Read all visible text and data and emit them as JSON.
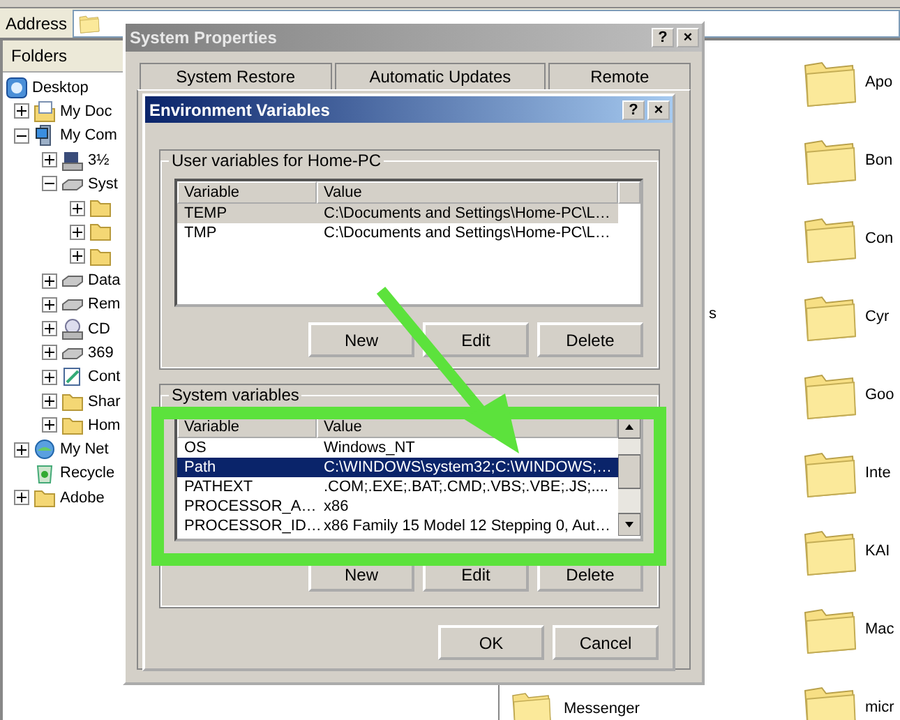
{
  "address_bar": {
    "label": "Address"
  },
  "folders_pane": {
    "title": "Folders",
    "tree": [
      {
        "label": "Desktop",
        "kind": "desktop",
        "children": [
          {
            "label": "My Doc",
            "kind": "documents",
            "expanded": false
          },
          {
            "label": "My Com",
            "kind": "computer",
            "expanded": true,
            "children": [
              {
                "label": "3½",
                "kind": "floppy",
                "expanded": false
              },
              {
                "label": "Syst",
                "kind": "drive",
                "expanded": true,
                "children": [
                  {
                    "kind": "folder",
                    "expanded": false
                  },
                  {
                    "kind": "folder",
                    "expanded": false
                  },
                  {
                    "kind": "folder",
                    "expanded": false
                  }
                ]
              },
              {
                "label": "Data",
                "kind": "drive",
                "expanded": false
              },
              {
                "label": "Rem",
                "kind": "drive",
                "expanded": false
              },
              {
                "label": "CD",
                "kind": "cdrom",
                "expanded": false
              },
              {
                "label": "369",
                "kind": "drive",
                "expanded": false
              },
              {
                "label": "Cont",
                "kind": "control",
                "expanded": false
              },
              {
                "label": "Shar",
                "kind": "folder",
                "expanded": false
              },
              {
                "label": "Hom",
                "kind": "folder",
                "expanded": false
              }
            ]
          },
          {
            "label": "My Net",
            "kind": "network",
            "expanded": false
          },
          {
            "label": "Recycle",
            "kind": "recycle"
          },
          {
            "label": "Adobe",
            "kind": "folder",
            "expanded": false
          }
        ]
      }
    ]
  },
  "file_list": {
    "column_fragments": [
      "s",
      "Messenger"
    ],
    "items": [
      "Apo",
      "Bon",
      "Con",
      "Cyr",
      "Goo",
      "Inte",
      "KAI",
      "Mac",
      "micr"
    ]
  },
  "system_properties": {
    "title": "System Properties",
    "title_buttons": [
      "?",
      "×"
    ],
    "tabs": [
      "System Restore",
      "Automatic Updates",
      "Remote"
    ]
  },
  "environment_variables": {
    "title": "Environment Variables",
    "title_buttons": [
      "?",
      "×"
    ],
    "user_group": {
      "legend": "User variables for Home-PC",
      "columns": [
        "Variable",
        "Value"
      ],
      "rows": [
        {
          "variable": "TEMP",
          "value": "C:\\Documents and Settings\\Home-PC\\L…",
          "selected": true
        },
        {
          "variable": "TMP",
          "value": "C:\\Documents and Settings\\Home-PC\\L…",
          "selected": false
        }
      ],
      "buttons": [
        "New",
        "Edit",
        "Delete"
      ]
    },
    "system_group": {
      "legend": "System variables",
      "columns": [
        "Variable",
        "Value"
      ],
      "rows": [
        {
          "variable": "OS",
          "value": "Windows_NT",
          "selected": false
        },
        {
          "variable": "Path",
          "value": "C:\\WINDOWS\\system32;C:\\WINDOWS;…",
          "selected": true
        },
        {
          "variable": "PATHEXT",
          "value": ".COM;.EXE;.BAT;.CMD;.VBS;.VBE;.JS;....",
          "selected": false
        },
        {
          "variable": "PROCESSOR_A…",
          "value": "x86",
          "selected": false
        },
        {
          "variable": "PROCESSOR_ID…",
          "value": "x86 Family 15 Model 12 Stepping 0, Aut…",
          "selected": false
        }
      ],
      "buttons": [
        "New",
        "Edit",
        "Delete"
      ]
    },
    "buttons": [
      "OK",
      "Cancel"
    ]
  }
}
